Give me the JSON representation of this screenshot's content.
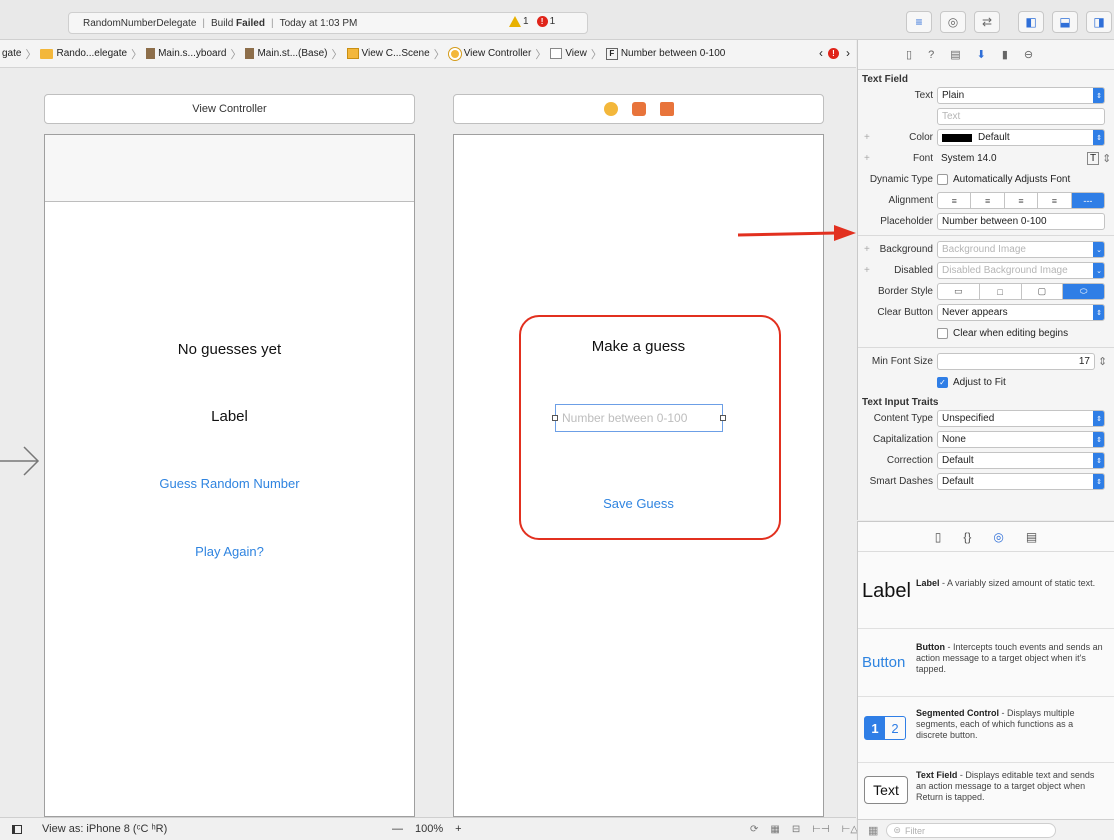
{
  "toolbar": {
    "activity": {
      "project": "RandomNumberDelegate",
      "build_prefix": "Build",
      "build_status": "Failed",
      "time": "Today at 1:03 PM",
      "warnings": "1",
      "errors": "1"
    }
  },
  "jumpbar": {
    "crumbs": [
      "gate",
      "Rando...elegate",
      "Main.s...yboard",
      "Main.st...(Base)",
      "View C...Scene",
      "View Controller",
      "View",
      "Number between 0-100"
    ],
    "field_letter": "F"
  },
  "canvas": {
    "left_scene": {
      "title": "View Controller",
      "status_label": "No guesses yet",
      "label": "Label",
      "guess_button": "Guess Random Number",
      "play_again_button": "Play Again?"
    },
    "right_scene": {
      "prompt": "Make a guess",
      "textfield_placeholder": "Number between 0-100",
      "save_button": "Save Guess"
    }
  },
  "bottombar": {
    "view_as": "View as: iPhone 8 (ᶜC ʰR)",
    "zoom_minus": "—",
    "zoom": "100%",
    "zoom_plus": "+"
  },
  "inspector": {
    "section": "Text Field",
    "text_label": "Text",
    "text_value": "Plain",
    "text_placeholder": "Text",
    "color_label": "Color",
    "color_value": "Default",
    "font_label": "Font",
    "font_value": "System 14.0",
    "dynamic_type_label": "Dynamic Type",
    "dynamic_type_value": "Automatically Adjusts Font",
    "alignment_label": "Alignment",
    "placeholder_label": "Placeholder",
    "placeholder_value": "Number between 0-100",
    "background_label": "Background",
    "background_value": "Background Image",
    "disabled_label": "Disabled",
    "disabled_value": "Disabled Background Image",
    "border_style_label": "Border Style",
    "clear_button_label": "Clear Button",
    "clear_button_value": "Never appears",
    "clear_editing": "Clear when editing begins",
    "min_font_label": "Min Font Size",
    "min_font_value": "17",
    "adjust_to_fit": "Adjust to Fit",
    "traits_section": "Text Input Traits",
    "content_type_label": "Content Type",
    "content_type_value": "Unspecified",
    "capitalization_label": "Capitalization",
    "capitalization_value": "None",
    "correction_label": "Correction",
    "correction_value": "Default",
    "smart_dashes_label": "Smart Dashes",
    "smart_dashes_value": "Default"
  },
  "library": {
    "items": [
      {
        "icon_text": "Label",
        "name": "Label",
        "desc": " - A variably sized amount of static text."
      },
      {
        "icon_text": "Button",
        "name": "Button",
        "desc": " - Intercepts touch events and sends an action message to a target object when it's tapped."
      },
      {
        "icon_text": "1 2",
        "name": "Segmented Control",
        "desc": " - Displays multiple segments, each of which functions as a discrete button."
      },
      {
        "icon_text": "Text",
        "name": "Text Field",
        "desc": " - Displays editable text and sends an action message to a target object when Return is tapped."
      }
    ],
    "filter_placeholder": "Filter"
  },
  "colors": {
    "accent": "#2f7ee6",
    "error": "#e0241a",
    "highlight": "#e2301f",
    "link": "#2f84e0"
  }
}
